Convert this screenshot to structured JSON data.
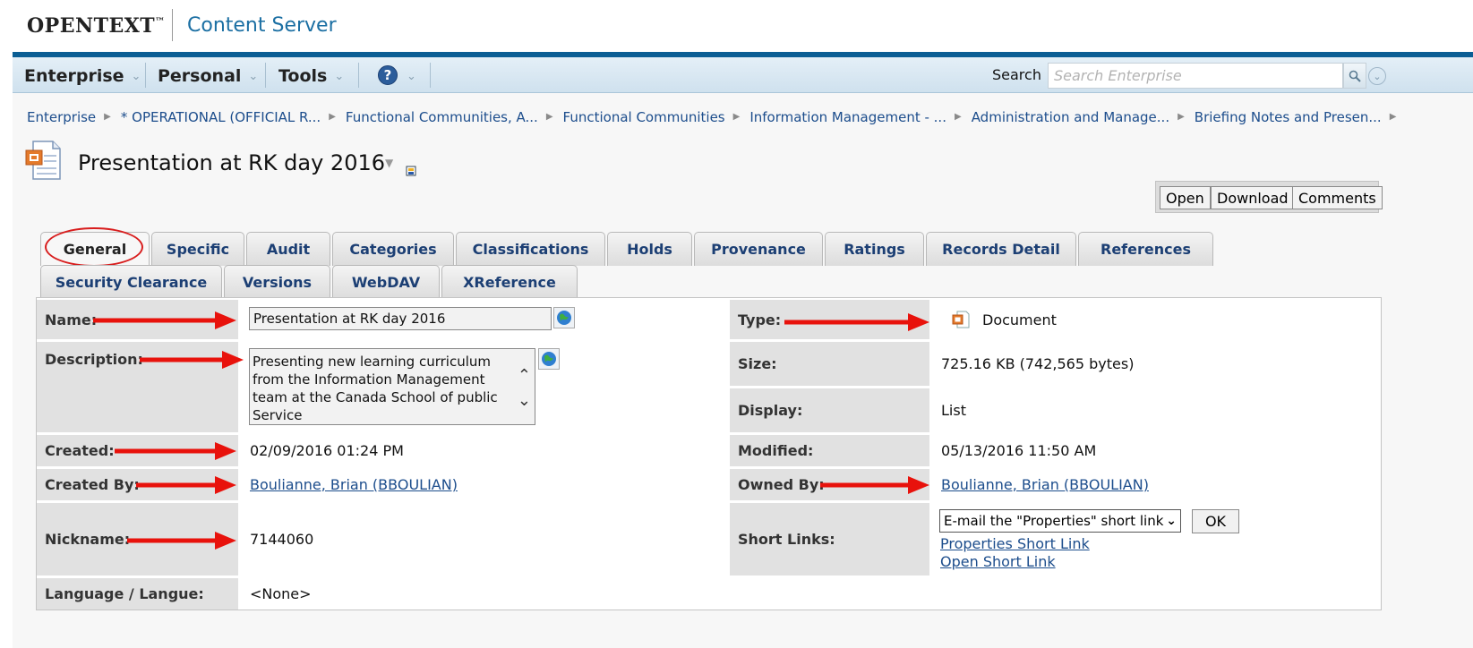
{
  "header": {
    "logo": "OPENTEXT",
    "logo_tm": "™",
    "product": "Content Server"
  },
  "menu": {
    "enterprise": "Enterprise",
    "personal": "Personal",
    "tools": "Tools",
    "help": "?",
    "search_label": "Search",
    "search_placeholder": "Search Enterprise"
  },
  "breadcrumbs": [
    "Enterprise",
    "* OPERATIONAL (OFFICIAL R...",
    "Functional Communities, A...",
    "Functional Communities",
    "Information Management - ...",
    "Administration and Manage...",
    "Briefing Notes and Presen..."
  ],
  "title": "Presentation at RK day 2016",
  "actions": {
    "open": "Open",
    "download": "Download",
    "comments": "Comments"
  },
  "tabs_row1": [
    "General",
    "Specific",
    "Audit",
    "Categories",
    "Classifications",
    "Holds",
    "Provenance",
    "Ratings",
    "Records Detail",
    "References"
  ],
  "tabs_row2": [
    "Security Clearance",
    "Versions",
    "WebDAV",
    "XReference"
  ],
  "fields": {
    "name_label": "Name:",
    "name_value": "Presentation at RK day 2016",
    "description_label": "Description:",
    "description_value": "Presenting new learning curriculum from the Information Management team at the Canada School of public Service",
    "created_label": "Created:",
    "created_value": "02/09/2016 01:24 PM",
    "created_by_label": "Created By:",
    "created_by_value": "Boulianne, Brian (BBOULIAN)",
    "nickname_label": "Nickname:",
    "nickname_value": "7144060",
    "language_label": "Language / Langue:",
    "language_value": "<None>",
    "type_label": "Type:",
    "type_value": "Document",
    "size_label": "Size:",
    "size_value": "725.16 KB (742,565 bytes)",
    "display_label": "Display:",
    "display_value": "List",
    "modified_label": "Modified:",
    "modified_value": "05/13/2016 11:50 AM",
    "owned_by_label": "Owned By:",
    "owned_by_value": "Boulianne, Brian (BBOULIAN)",
    "short_links_label": "Short Links:",
    "short_links_select": "E-mail the \"Properties\" short link",
    "ok": "OK",
    "properties_link": "Properties Short Link",
    "open_link": "Open Short Link"
  },
  "colors": {
    "annotation_red": "#e8120c",
    "brand_blue": "#0b5e94",
    "link_blue": "#1c4d8c"
  }
}
